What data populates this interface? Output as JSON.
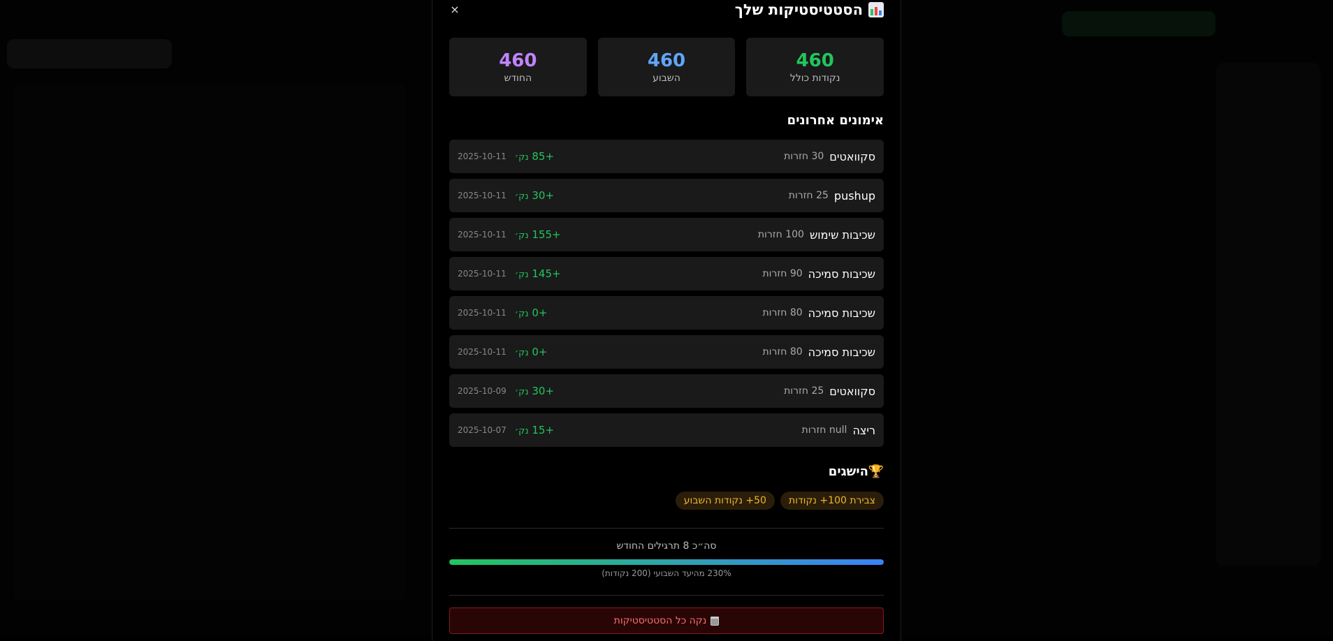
{
  "modal": {
    "title": "הסטטיסטיקות שלך",
    "close_label": "×",
    "stats": [
      {
        "value": "460",
        "label": "נקודות כולל",
        "color": "#22c55e"
      },
      {
        "value": "460",
        "label": "השבוע",
        "color": "#60a5fa"
      },
      {
        "value": "460",
        "label": "החודש",
        "color": "#c084fc"
      }
    ],
    "recent_title": "אימונים אחרונים",
    "workouts": [
      {
        "name": "סקוואטים",
        "reps": "30 חזרות",
        "points": "+85",
        "unit": "נק׳",
        "date": "2025-10-11"
      },
      {
        "name": "pushup",
        "reps": "25 חזרות",
        "points": "+30",
        "unit": "נק׳",
        "date": "2025-10-11"
      },
      {
        "name": "שכיבות שימוש",
        "reps": "100 חזרות",
        "points": "+155",
        "unit": "נק׳",
        "date": "2025-10-11"
      },
      {
        "name": "שכיבות סמיכה",
        "reps": "90 חזרות",
        "points": "+145",
        "unit": "נק׳",
        "date": "2025-10-11"
      },
      {
        "name": "שכיבות סמיכה",
        "reps": "80 חזרות",
        "points": "+0",
        "unit": "נק׳",
        "date": "2025-10-11"
      },
      {
        "name": "שכיבות סמיכה",
        "reps": "80 חזרות",
        "points": "+0",
        "unit": "נק׳",
        "date": "2025-10-11"
      },
      {
        "name": "סקוואטים",
        "reps": "25 חזרות",
        "points": "+30",
        "unit": "נק׳",
        "date": "2025-10-09"
      },
      {
        "name": "ריצה",
        "reps": "null חזרות",
        "points": "+15",
        "unit": "נק׳",
        "date": "2025-10-07"
      }
    ],
    "achievements_title": "הישגים",
    "achievements": [
      "צבירת 100+ נקודות",
      "50+ נקודות השבוע"
    ],
    "summary": "סה״כ 8 תרגילים החודש",
    "progress_fraction": 1.0,
    "progress_caption": "230% מהיעד השבועי (200 נקודות)",
    "clear_label": "נקה כל הסטטיסטיקות"
  }
}
